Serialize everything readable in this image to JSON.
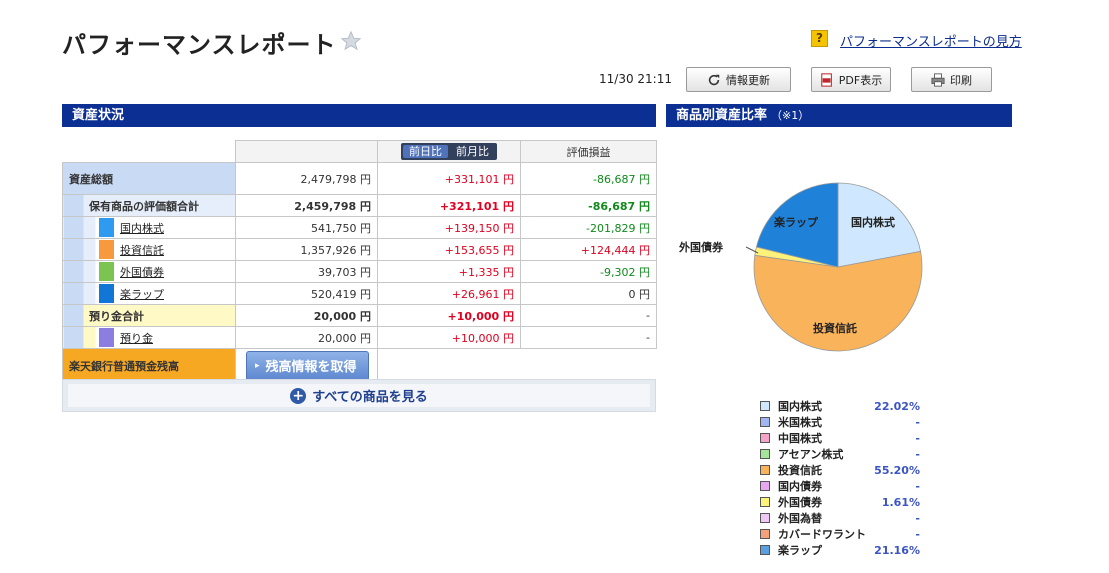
{
  "header": {
    "title": "パフォーマンスレポート",
    "help_link": "パフォーマンスレポートの見方",
    "help_icon_label": "?",
    "timestamp": "11/30 21:11",
    "refresh_label": "情報更新",
    "pdf_label": "PDF表示",
    "print_label": "印刷"
  },
  "sections": {
    "assets_title": "資産状況",
    "ratio_title": "商品別資産比率",
    "ratio_note": "（※1）"
  },
  "table": {
    "toggle": [
      "前日比",
      "前月比"
    ],
    "col_pl": "評価損益",
    "total": {
      "label": "資産総額",
      "value": "2,479,798 円",
      "change": "+331,101 円",
      "pl": "-86,687 円"
    },
    "held": {
      "label": "保有商品の評価額合計",
      "value": "2,459,798 円",
      "change": "+321,101 円",
      "pl": "-86,687 円"
    },
    "items": [
      {
        "label": "国内株式",
        "value": "541,750 円",
        "change": "+139,150 円",
        "pl": "-201,829 円",
        "color": "#2e9bf0"
      },
      {
        "label": "投資信託",
        "value": "1,357,926 円",
        "change": "+153,655 円",
        "pl": "+124,444 円",
        "color": "#f79a3e"
      },
      {
        "label": "外国債券",
        "value": "39,703 円",
        "change": "+1,335 円",
        "pl": "-9,302 円",
        "color": "#7cc451"
      },
      {
        "label": "楽ラップ",
        "value": "520,419 円",
        "change": "+26,961 円",
        "pl": "0 円",
        "color": "#1276d6"
      }
    ],
    "deposit_total": {
      "label": "預り金合計",
      "value": "20,000 円",
      "change": "+10,000 円",
      "pl": "-"
    },
    "deposit": {
      "label": "預り金",
      "value": "20,000 円",
      "change": "+10,000 円",
      "pl": "-",
      "color": "#8c7ee0"
    },
    "bank": {
      "label": "楽天銀行普通預金残高",
      "button": "残高情報を取得"
    },
    "see_all": "すべての商品を見る"
  },
  "chart_data": {
    "type": "pie",
    "slices": [
      {
        "label": "国内株式",
        "value": 22.02,
        "color": "#cfe8ff"
      },
      {
        "label": "投資信託",
        "value": 55.2,
        "color": "#f9b35a"
      },
      {
        "label": "外国債券",
        "value": 1.61,
        "color": "#fff27a"
      },
      {
        "label": "楽ラップ",
        "value": 21.16,
        "color": "#1f82d8"
      }
    ],
    "legend": [
      {
        "name": "国内株式",
        "value": "22.02%",
        "color": "#cfe8ff"
      },
      {
        "name": "米国株式",
        "value": "-",
        "color": "#9fb6f0"
      },
      {
        "name": "中国株式",
        "value": "-",
        "color": "#f5a3c8"
      },
      {
        "name": "アセアン株式",
        "value": "-",
        "color": "#a5e59a"
      },
      {
        "name": "投資信託",
        "value": "55.20%",
        "color": "#f9b35a"
      },
      {
        "name": "国内債券",
        "value": "-",
        "color": "#e8a7f0"
      },
      {
        "name": "外国債券",
        "value": "1.61%",
        "color": "#fff27a"
      },
      {
        "name": "外国為替",
        "value": "-",
        "color": "#f0c8f5"
      },
      {
        "name": "カバードワラント",
        "value": "-",
        "color": "#f4a07a"
      },
      {
        "name": "楽ラップ",
        "value": "21.16%",
        "color": "#5aa0e0"
      }
    ]
  }
}
